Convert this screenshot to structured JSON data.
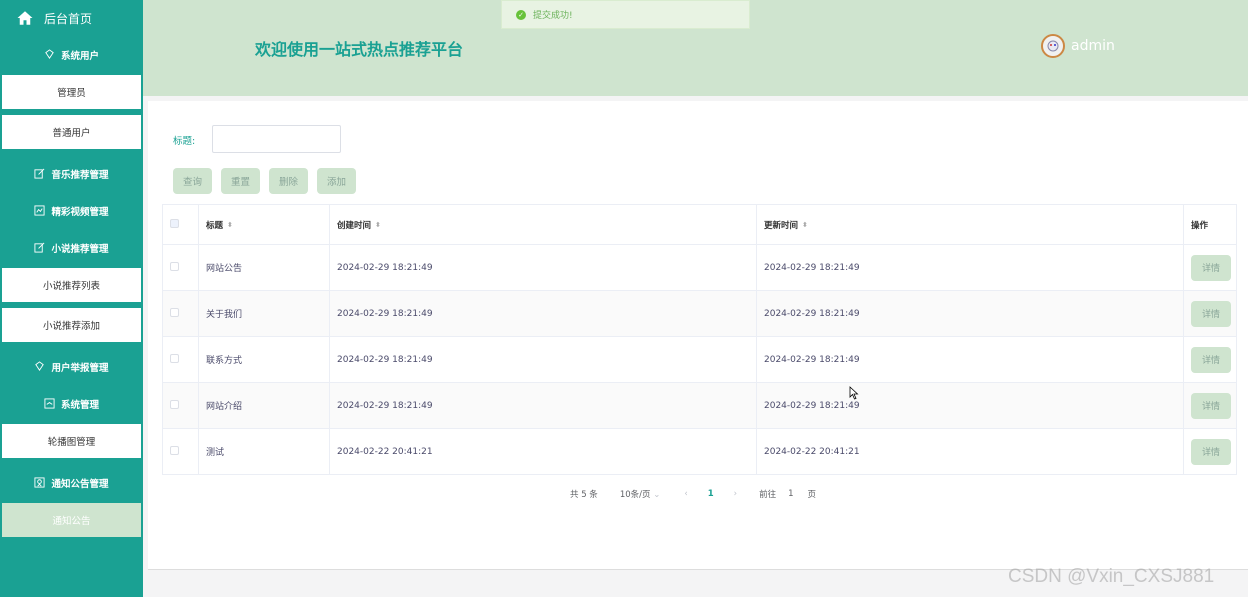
{
  "sidebar": {
    "home_label": "后台首页",
    "groups": [
      {
        "label": "系统用户",
        "icon": "shield-icon"
      },
      {
        "label": "音乐推荐管理",
        "icon": "edit-icon"
      },
      {
        "label": "精彩视频管理",
        "icon": "chart-icon"
      },
      {
        "label": "小说推荐管理",
        "icon": "edit-icon"
      },
      {
        "label": "用户举报管理",
        "icon": "shield-icon"
      },
      {
        "label": "系统管理",
        "icon": "chart-icon"
      },
      {
        "label": "通知公告管理",
        "icon": "badge-icon"
      }
    ],
    "items": {
      "admin": "管理员",
      "normal_user": "普通用户",
      "novel_list": "小说推荐列表",
      "novel_add": "小说推荐添加",
      "carousel": "轮播图管理",
      "notice": "通知公告"
    }
  },
  "toast": {
    "message": "提交成功!"
  },
  "header": {
    "title": "欢迎使用一站式热点推荐平台",
    "username": "admin"
  },
  "filter": {
    "label": "标题:",
    "value": ""
  },
  "buttons": {
    "query": "查询",
    "reset": "重置",
    "delete": "删除",
    "add": "添加"
  },
  "table": {
    "headers": {
      "title": "标题",
      "created": "创建时间",
      "updated": "更新时间",
      "actions": "操作"
    },
    "detail_label": "详情",
    "rows": [
      {
        "title": "网站公告",
        "created": "2024-02-29 18:21:49",
        "updated": "2024-02-29 18:21:49"
      },
      {
        "title": "关于我们",
        "created": "2024-02-29 18:21:49",
        "updated": "2024-02-29 18:21:49"
      },
      {
        "title": "联系方式",
        "created": "2024-02-29 18:21:49",
        "updated": "2024-02-29 18:21:49"
      },
      {
        "title": "网站介绍",
        "created": "2024-02-29 18:21:49",
        "updated": "2024-02-29 18:21:49"
      },
      {
        "title": "测试",
        "created": "2024-02-22 20:41:21",
        "updated": "2024-02-22 20:41:21"
      }
    ]
  },
  "pagination": {
    "total": "共 5 条",
    "page_size": "10条/页",
    "current_page": "1",
    "goto_label": "前往",
    "goto_value": "1",
    "page_suffix": "页"
  },
  "watermark": "CSDN @Vxin_CXSJ881",
  "colors": {
    "accent": "#1aa193",
    "header_bg": "#cfe4cf",
    "button_bg": "#cfe4cf",
    "success": "#67c23a"
  }
}
